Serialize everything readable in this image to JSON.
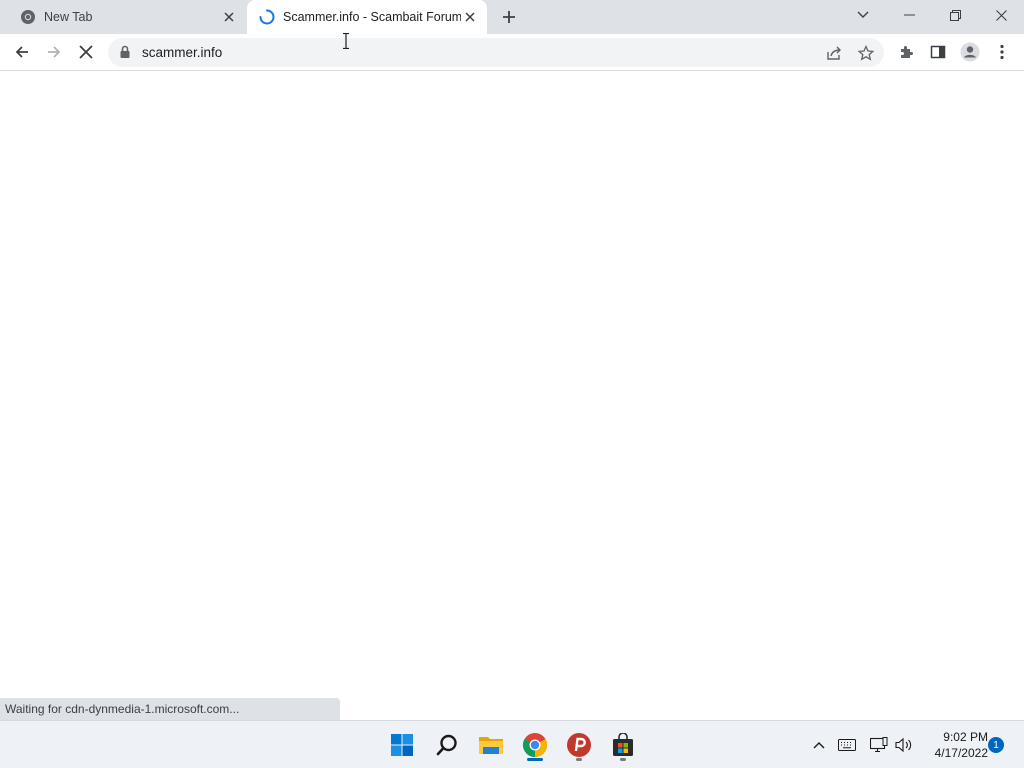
{
  "browser": {
    "tabs": [
      {
        "title": "New Tab",
        "active": false,
        "icon": "chrome-icon"
      },
      {
        "title": "Scammer.info - Scambait Forum",
        "active": true,
        "icon": "loading-spinner-icon"
      }
    ],
    "address": {
      "url": "scammer.info",
      "icon": "lock-icon"
    },
    "status_text": "Waiting for cdn-dynmedia-1.microsoft.com..."
  },
  "taskbar": {
    "apps": [
      "start-icon",
      "search-icon",
      "file-explorer-icon",
      "chrome-icon",
      "psiphon-icon",
      "store-icon"
    ],
    "clock": {
      "time": "9:02 PM",
      "date": "4/17/2022"
    },
    "notification_count": "1"
  },
  "colors": {
    "accent": "#1a73e8",
    "tabstrip": "#dee1e6",
    "taskbar": "#eef1f6"
  }
}
